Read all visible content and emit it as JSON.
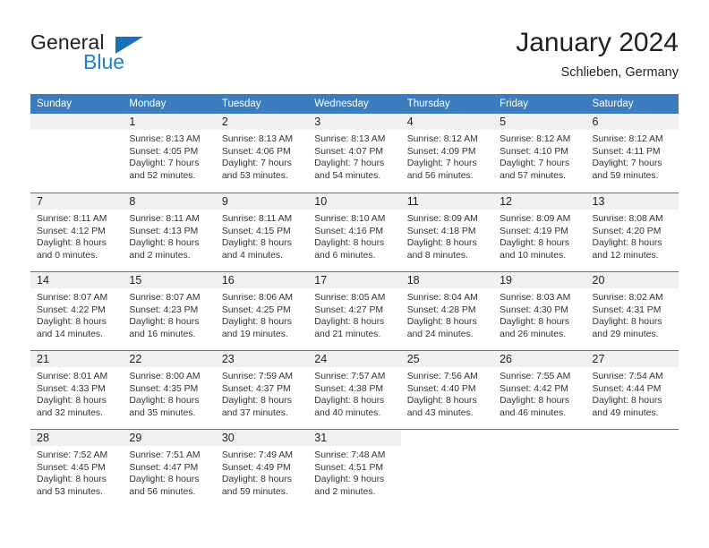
{
  "brand": {
    "word1": "General",
    "word2": "Blue",
    "triangle_color": "#1c6fba",
    "blue_color": "#1c7fd6"
  },
  "header": {
    "title": "January 2024",
    "subtitle": "Schlieben, Germany",
    "header_bg": "#3b7dbf",
    "header_text_color": "#ffffff"
  },
  "weekday_headers": [
    "Sunday",
    "Monday",
    "Tuesday",
    "Wednesday",
    "Thursday",
    "Friday",
    "Saturday"
  ],
  "weeks": [
    [
      {
        "day": "",
        "sunrise": "",
        "sunset": "",
        "daylight1": "",
        "daylight2": ""
      },
      {
        "day": "1",
        "sunrise": "Sunrise: 8:13 AM",
        "sunset": "Sunset: 4:05 PM",
        "daylight1": "Daylight: 7 hours",
        "daylight2": "and 52 minutes."
      },
      {
        "day": "2",
        "sunrise": "Sunrise: 8:13 AM",
        "sunset": "Sunset: 4:06 PM",
        "daylight1": "Daylight: 7 hours",
        "daylight2": "and 53 minutes."
      },
      {
        "day": "3",
        "sunrise": "Sunrise: 8:13 AM",
        "sunset": "Sunset: 4:07 PM",
        "daylight1": "Daylight: 7 hours",
        "daylight2": "and 54 minutes."
      },
      {
        "day": "4",
        "sunrise": "Sunrise: 8:12 AM",
        "sunset": "Sunset: 4:09 PM",
        "daylight1": "Daylight: 7 hours",
        "daylight2": "and 56 minutes."
      },
      {
        "day": "5",
        "sunrise": "Sunrise: 8:12 AM",
        "sunset": "Sunset: 4:10 PM",
        "daylight1": "Daylight: 7 hours",
        "daylight2": "and 57 minutes."
      },
      {
        "day": "6",
        "sunrise": "Sunrise: 8:12 AM",
        "sunset": "Sunset: 4:11 PM",
        "daylight1": "Daylight: 7 hours",
        "daylight2": "and 59 minutes."
      }
    ],
    [
      {
        "day": "7",
        "sunrise": "Sunrise: 8:11 AM",
        "sunset": "Sunset: 4:12 PM",
        "daylight1": "Daylight: 8 hours",
        "daylight2": "and 0 minutes."
      },
      {
        "day": "8",
        "sunrise": "Sunrise: 8:11 AM",
        "sunset": "Sunset: 4:13 PM",
        "daylight1": "Daylight: 8 hours",
        "daylight2": "and 2 minutes."
      },
      {
        "day": "9",
        "sunrise": "Sunrise: 8:11 AM",
        "sunset": "Sunset: 4:15 PM",
        "daylight1": "Daylight: 8 hours",
        "daylight2": "and 4 minutes."
      },
      {
        "day": "10",
        "sunrise": "Sunrise: 8:10 AM",
        "sunset": "Sunset: 4:16 PM",
        "daylight1": "Daylight: 8 hours",
        "daylight2": "and 6 minutes."
      },
      {
        "day": "11",
        "sunrise": "Sunrise: 8:09 AM",
        "sunset": "Sunset: 4:18 PM",
        "daylight1": "Daylight: 8 hours",
        "daylight2": "and 8 minutes."
      },
      {
        "day": "12",
        "sunrise": "Sunrise: 8:09 AM",
        "sunset": "Sunset: 4:19 PM",
        "daylight1": "Daylight: 8 hours",
        "daylight2": "and 10 minutes."
      },
      {
        "day": "13",
        "sunrise": "Sunrise: 8:08 AM",
        "sunset": "Sunset: 4:20 PM",
        "daylight1": "Daylight: 8 hours",
        "daylight2": "and 12 minutes."
      }
    ],
    [
      {
        "day": "14",
        "sunrise": "Sunrise: 8:07 AM",
        "sunset": "Sunset: 4:22 PM",
        "daylight1": "Daylight: 8 hours",
        "daylight2": "and 14 minutes."
      },
      {
        "day": "15",
        "sunrise": "Sunrise: 8:07 AM",
        "sunset": "Sunset: 4:23 PM",
        "daylight1": "Daylight: 8 hours",
        "daylight2": "and 16 minutes."
      },
      {
        "day": "16",
        "sunrise": "Sunrise: 8:06 AM",
        "sunset": "Sunset: 4:25 PM",
        "daylight1": "Daylight: 8 hours",
        "daylight2": "and 19 minutes."
      },
      {
        "day": "17",
        "sunrise": "Sunrise: 8:05 AM",
        "sunset": "Sunset: 4:27 PM",
        "daylight1": "Daylight: 8 hours",
        "daylight2": "and 21 minutes."
      },
      {
        "day": "18",
        "sunrise": "Sunrise: 8:04 AM",
        "sunset": "Sunset: 4:28 PM",
        "daylight1": "Daylight: 8 hours",
        "daylight2": "and 24 minutes."
      },
      {
        "day": "19",
        "sunrise": "Sunrise: 8:03 AM",
        "sunset": "Sunset: 4:30 PM",
        "daylight1": "Daylight: 8 hours",
        "daylight2": "and 26 minutes."
      },
      {
        "day": "20",
        "sunrise": "Sunrise: 8:02 AM",
        "sunset": "Sunset: 4:31 PM",
        "daylight1": "Daylight: 8 hours",
        "daylight2": "and 29 minutes."
      }
    ],
    [
      {
        "day": "21",
        "sunrise": "Sunrise: 8:01 AM",
        "sunset": "Sunset: 4:33 PM",
        "daylight1": "Daylight: 8 hours",
        "daylight2": "and 32 minutes."
      },
      {
        "day": "22",
        "sunrise": "Sunrise: 8:00 AM",
        "sunset": "Sunset: 4:35 PM",
        "daylight1": "Daylight: 8 hours",
        "daylight2": "and 35 minutes."
      },
      {
        "day": "23",
        "sunrise": "Sunrise: 7:59 AM",
        "sunset": "Sunset: 4:37 PM",
        "daylight1": "Daylight: 8 hours",
        "daylight2": "and 37 minutes."
      },
      {
        "day": "24",
        "sunrise": "Sunrise: 7:57 AM",
        "sunset": "Sunset: 4:38 PM",
        "daylight1": "Daylight: 8 hours",
        "daylight2": "and 40 minutes."
      },
      {
        "day": "25",
        "sunrise": "Sunrise: 7:56 AM",
        "sunset": "Sunset: 4:40 PM",
        "daylight1": "Daylight: 8 hours",
        "daylight2": "and 43 minutes."
      },
      {
        "day": "26",
        "sunrise": "Sunrise: 7:55 AM",
        "sunset": "Sunset: 4:42 PM",
        "daylight1": "Daylight: 8 hours",
        "daylight2": "and 46 minutes."
      },
      {
        "day": "27",
        "sunrise": "Sunrise: 7:54 AM",
        "sunset": "Sunset: 4:44 PM",
        "daylight1": "Daylight: 8 hours",
        "daylight2": "and 49 minutes."
      }
    ],
    [
      {
        "day": "28",
        "sunrise": "Sunrise: 7:52 AM",
        "sunset": "Sunset: 4:45 PM",
        "daylight1": "Daylight: 8 hours",
        "daylight2": "and 53 minutes."
      },
      {
        "day": "29",
        "sunrise": "Sunrise: 7:51 AM",
        "sunset": "Sunset: 4:47 PM",
        "daylight1": "Daylight: 8 hours",
        "daylight2": "and 56 minutes."
      },
      {
        "day": "30",
        "sunrise": "Sunrise: 7:49 AM",
        "sunset": "Sunset: 4:49 PM",
        "daylight1": "Daylight: 8 hours",
        "daylight2": "and 59 minutes."
      },
      {
        "day": "31",
        "sunrise": "Sunrise: 7:48 AM",
        "sunset": "Sunset: 4:51 PM",
        "daylight1": "Daylight: 9 hours",
        "daylight2": "and 2 minutes."
      },
      {
        "day": "",
        "sunrise": "",
        "sunset": "",
        "daylight1": "",
        "daylight2": ""
      },
      {
        "day": "",
        "sunrise": "",
        "sunset": "",
        "daylight1": "",
        "daylight2": ""
      },
      {
        "day": "",
        "sunrise": "",
        "sunset": "",
        "daylight1": "",
        "daylight2": ""
      }
    ]
  ]
}
